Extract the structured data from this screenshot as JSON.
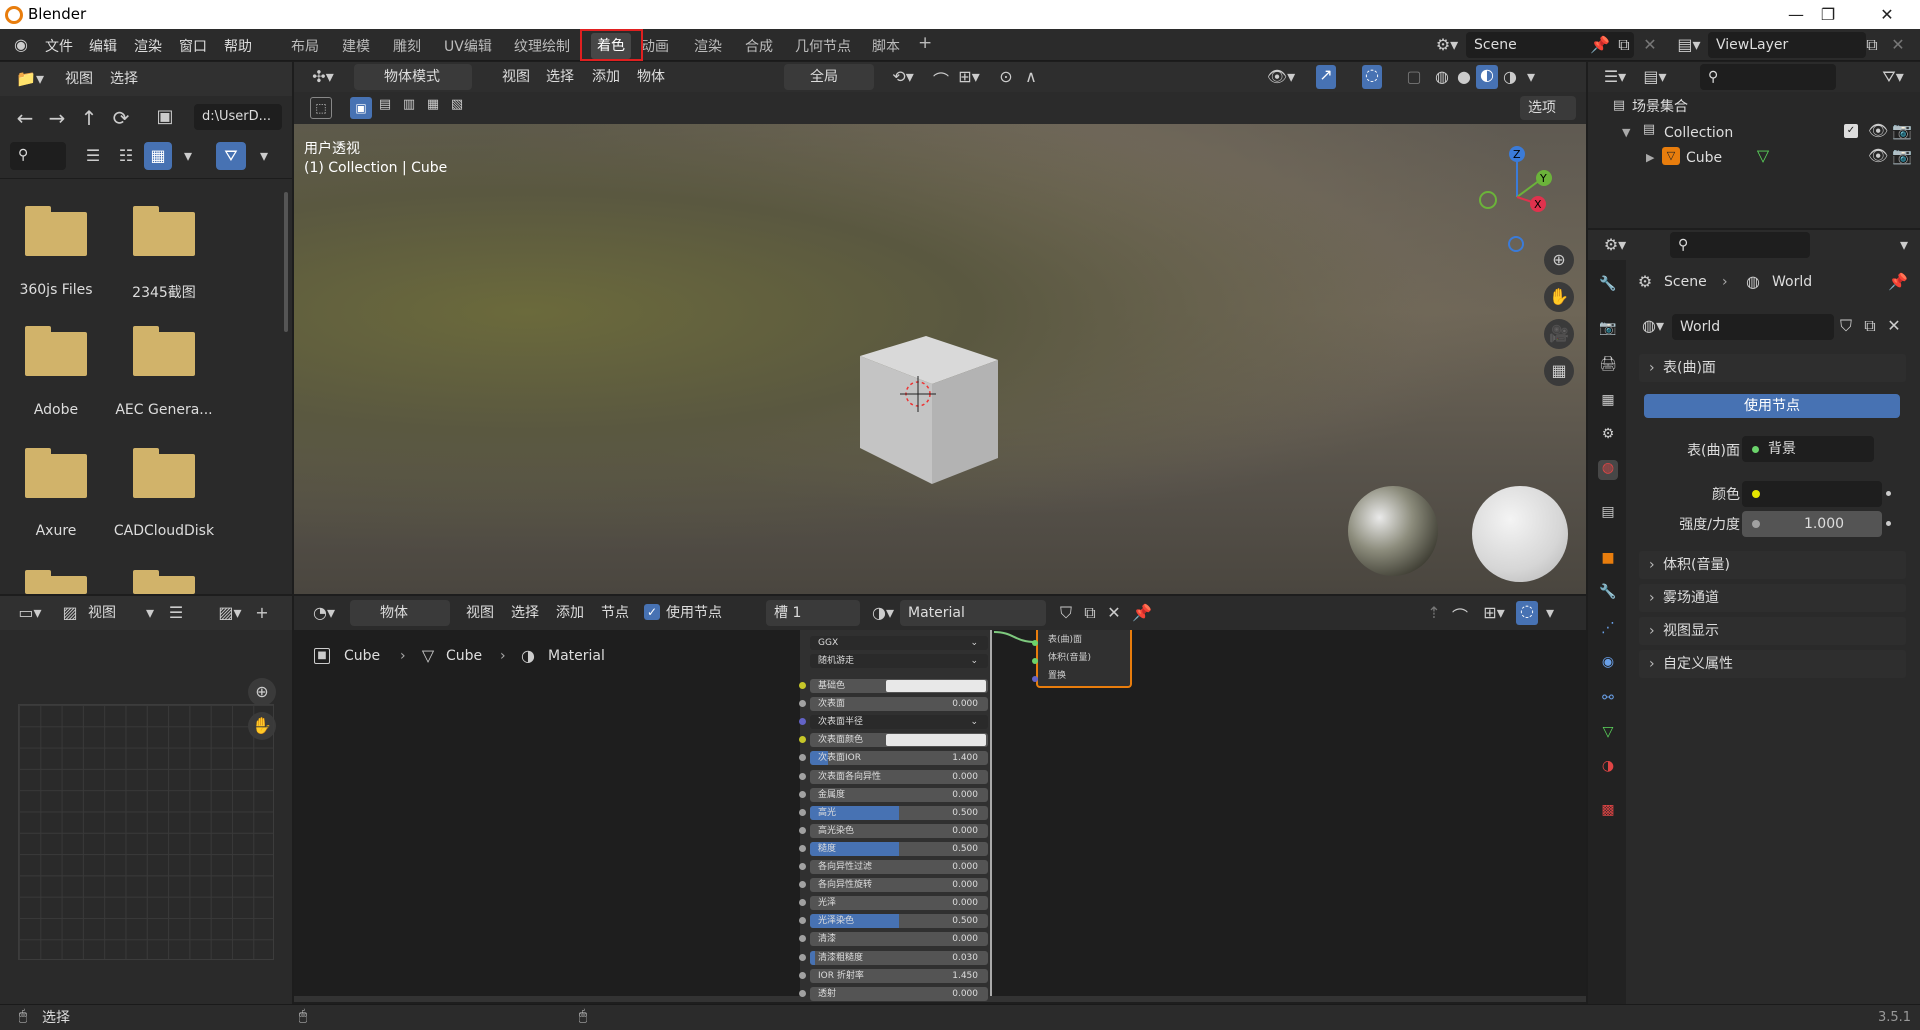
{
  "app": {
    "title": "Blender",
    "version": "3.5.1"
  },
  "menu": [
    "文件",
    "编辑",
    "渲染",
    "窗口",
    "帮助"
  ],
  "workspaces": [
    "布局",
    "建模",
    "雕刻",
    "UV编辑",
    "纹理绘制",
    "着色",
    "动画",
    "渲染",
    "合成",
    "几何节点",
    "脚本",
    "+"
  ],
  "scene": {
    "name": "Scene",
    "viewlayer": "ViewLayer"
  },
  "filebrowser": {
    "menu_view": "视图",
    "menu_select": "选择",
    "path": "d:\\UserD...",
    "folders": [
      "360js Files",
      "2345截图",
      "Adobe",
      "AEC Genera...",
      "Axure",
      "CADCloudDisk"
    ]
  },
  "viewport": {
    "mode": "物体模式",
    "menus": [
      "视图",
      "选择",
      "添加",
      "物体"
    ],
    "transform": "全局",
    "options": "选项",
    "view_title": "用户透视",
    "view_subtitle": "(1) Collection | Cube"
  },
  "image_editor": {
    "menu_view": "视图"
  },
  "node_editor": {
    "mode": "物体",
    "menus": [
      "视图",
      "选择",
      "添加",
      "节点"
    ],
    "use_nodes": "使用节点",
    "slot": "槽 1",
    "material": "Material",
    "breadcrumb": [
      "Cube",
      "Cube",
      "Material"
    ],
    "dropdowns": [
      "GGX",
      "随机游走"
    ],
    "rows": [
      {
        "label": "基础色",
        "value": "",
        "color": true
      },
      {
        "label": "次表面",
        "value": "0.000"
      },
      {
        "label": "次表面半径",
        "value": "",
        "dropdown": true
      },
      {
        "label": "次表面颜色",
        "value": "",
        "color": true
      },
      {
        "label": "次表面IOR",
        "value": "1.400",
        "fill": 0.1
      },
      {
        "label": "次表面各向异性",
        "value": "0.000"
      },
      {
        "label": "金属度",
        "value": "0.000"
      },
      {
        "label": "高光",
        "value": "0.500",
        "fill": 0.5
      },
      {
        "label": "高光染色",
        "value": "0.000"
      },
      {
        "label": "糙度",
        "value": "0.500",
        "fill": 0.5
      },
      {
        "label": "各向异性过滤",
        "value": "0.000"
      },
      {
        "label": "各向异性旋转",
        "value": "0.000"
      },
      {
        "label": "光泽",
        "value": "0.000"
      },
      {
        "label": "光泽染色",
        "value": "0.500",
        "fill": 0.5
      },
      {
        "label": "清漆",
        "value": "0.000"
      },
      {
        "label": "清漆粗糙度",
        "value": "0.030",
        "fill": 0.03
      },
      {
        "label": "IOR 折射率",
        "value": "1.450"
      },
      {
        "label": "透射",
        "value": "0.000"
      }
    ],
    "output_sockets": [
      "表(曲)面",
      "体积(音量)",
      "置换"
    ]
  },
  "outliner": {
    "root": "场景集合",
    "collection": "Collection",
    "object": "Cube"
  },
  "properties": {
    "breadcrumb_scene": "Scene",
    "breadcrumb_world": "World",
    "world_name": "World",
    "surface_section": "表(曲)面",
    "use_nodes_btn": "使用节点",
    "surface_label": "表(曲)面",
    "surface_value": "背景",
    "color_label": "颜色",
    "strength_label": "强度/力度",
    "strength_value": "1.000",
    "sections": [
      "体积(音量)",
      "雾场通道",
      "视图显示",
      "自定义属性"
    ]
  },
  "statusbar": {
    "select": "选择"
  },
  "colors": {
    "accent": "#4772b3",
    "highlight_box": "#e02020",
    "folder": "#d1b36a"
  }
}
